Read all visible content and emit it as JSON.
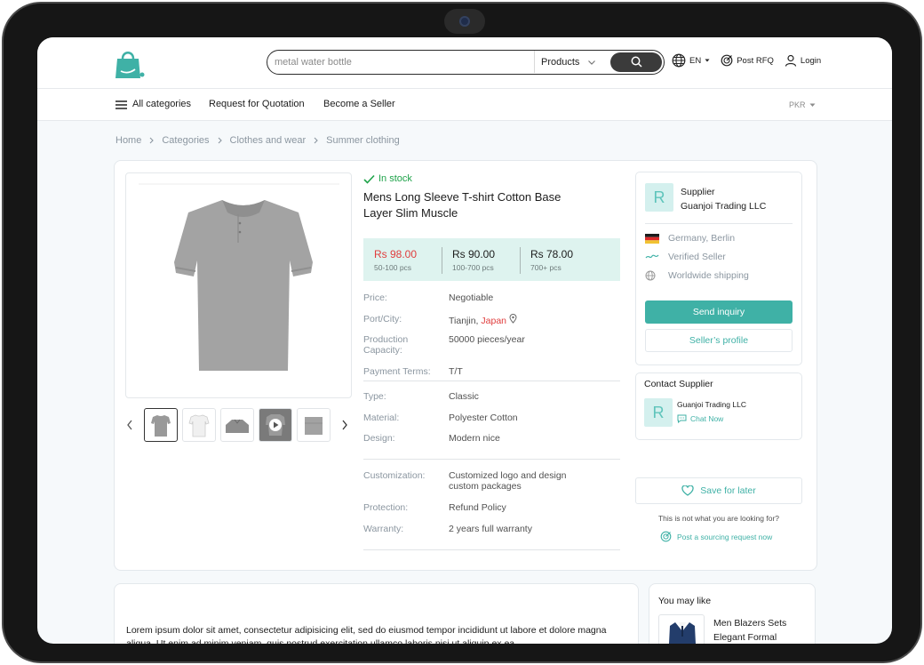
{
  "header": {
    "search": {
      "value": "metal water bottle",
      "category": "Products"
    },
    "language": "EN",
    "post_rfq": "Post RFQ",
    "login": "Login"
  },
  "nav": {
    "all_categories": "All categories",
    "request_quotation": "Request for Quotation",
    "become_seller": "Become a Seller",
    "currency": "PKR"
  },
  "breadcrumb": [
    "Home",
    "Categories",
    "Clothes and wear",
    "Summer clothing"
  ],
  "product": {
    "stock": "In stock",
    "title": "Mens Long Sleeve T-shirt Cotton Base Layer Slim Muscle",
    "prices": [
      {
        "value": "Rs 98.00",
        "qty": "50-100 pcs"
      },
      {
        "value": "Rs 90.00",
        "qty": "100-700 pcs"
      },
      {
        "value": "Rs 78.00",
        "qty": "700+ pcs"
      }
    ],
    "specs_1": {
      "price_key": "Price:",
      "price_val": "Negotiable",
      "port_key": "Port/City:",
      "port_city": "Tianjin,",
      "port_country": "Japan",
      "capacity_key": "Production Capacity:",
      "capacity_val": "50000 pieces/year",
      "payment_key": "Payment Terms:",
      "payment_val": "T/T"
    },
    "specs_2": {
      "type_key": "Type:",
      "type_val": "Classic",
      "material_key": "Material:",
      "material_val": "Polyester Cotton",
      "design_key": "Design:",
      "design_val": "Modern nice"
    },
    "specs_3": {
      "custom_key": "Customization:",
      "custom_val": "Customized logo and design custom packages",
      "protection_key": "Protection:",
      "protection_val": "Refund Policy",
      "warranty_key": "Warranty:",
      "warranty_val": "2 years full warranty"
    }
  },
  "supplier": {
    "initial": "R",
    "label": "Supplier",
    "name": "Guanjoi Trading LLC",
    "location": "Germany, Berlin",
    "verified": "Verified Seller",
    "shipping": "Worldwide shipping",
    "send_inquiry": "Send inquiry",
    "profile": "Seller’s profile"
  },
  "contact": {
    "title": "Contact Supplier",
    "initial": "R",
    "name": "Guanjoi Trading LLC",
    "chat": "Chat Now"
  },
  "save": "Save for later",
  "not_looking": "This is not what you are looking for?",
  "sourcing": "Post a sourcing request now",
  "description": "Lorem ipsum dolor sit amet, consectetur adipisicing elit, sed do eiusmod tempor incididunt ut labore et dolore magna aliqua. Ut enim ad minim veniam, quis nostrud exercitation ullamco laboris nisi ut aliquip ex ea",
  "you_may_like": {
    "title": "You may like",
    "item_name": "Men Blazers Sets Elegant Formal"
  },
  "colors": {
    "accent": "#3fb1a6",
    "price_bg": "#def3ef",
    "red": "#e03d3d",
    "stock": "#1fa34a"
  }
}
